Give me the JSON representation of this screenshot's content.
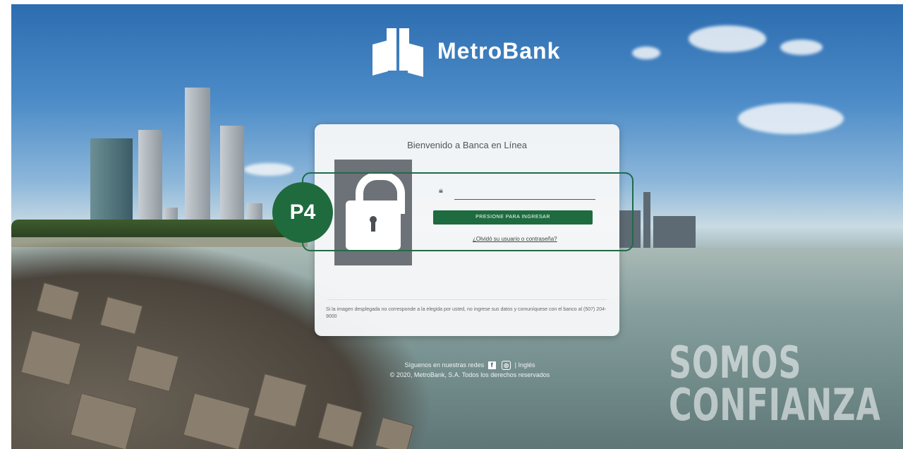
{
  "brand": {
    "name": "MetroBank",
    "logo_icon": "metrobank-logo-icon",
    "accent": "#1f6b3d"
  },
  "login": {
    "title": "Bienvenido a Banca en Línea",
    "user_icon": "user-icon",
    "username_value": "",
    "button_label": "PRESIONE PARA INGRESAR",
    "forgot_link": "¿Olvidó su usuario o contraseña?",
    "lock_icon": "lock-icon",
    "disclaimer": "Si la imagen desplegada no corresponde a la elegida por usted, no ingrese sus datos y comuníquese con el banco al (507) 204-9000"
  },
  "callout": {
    "label": "P4"
  },
  "footer": {
    "social_text": "Síguenos en nuestras redes",
    "social_icons": [
      "facebook-icon",
      "instagram-icon"
    ],
    "language_link": "Inglés",
    "copyright": "© 2020, MetroBank, S.A. Todos los derechos reservados"
  },
  "tagline": {
    "line1": "SOMOS",
    "line2": "CONFIANZA"
  }
}
